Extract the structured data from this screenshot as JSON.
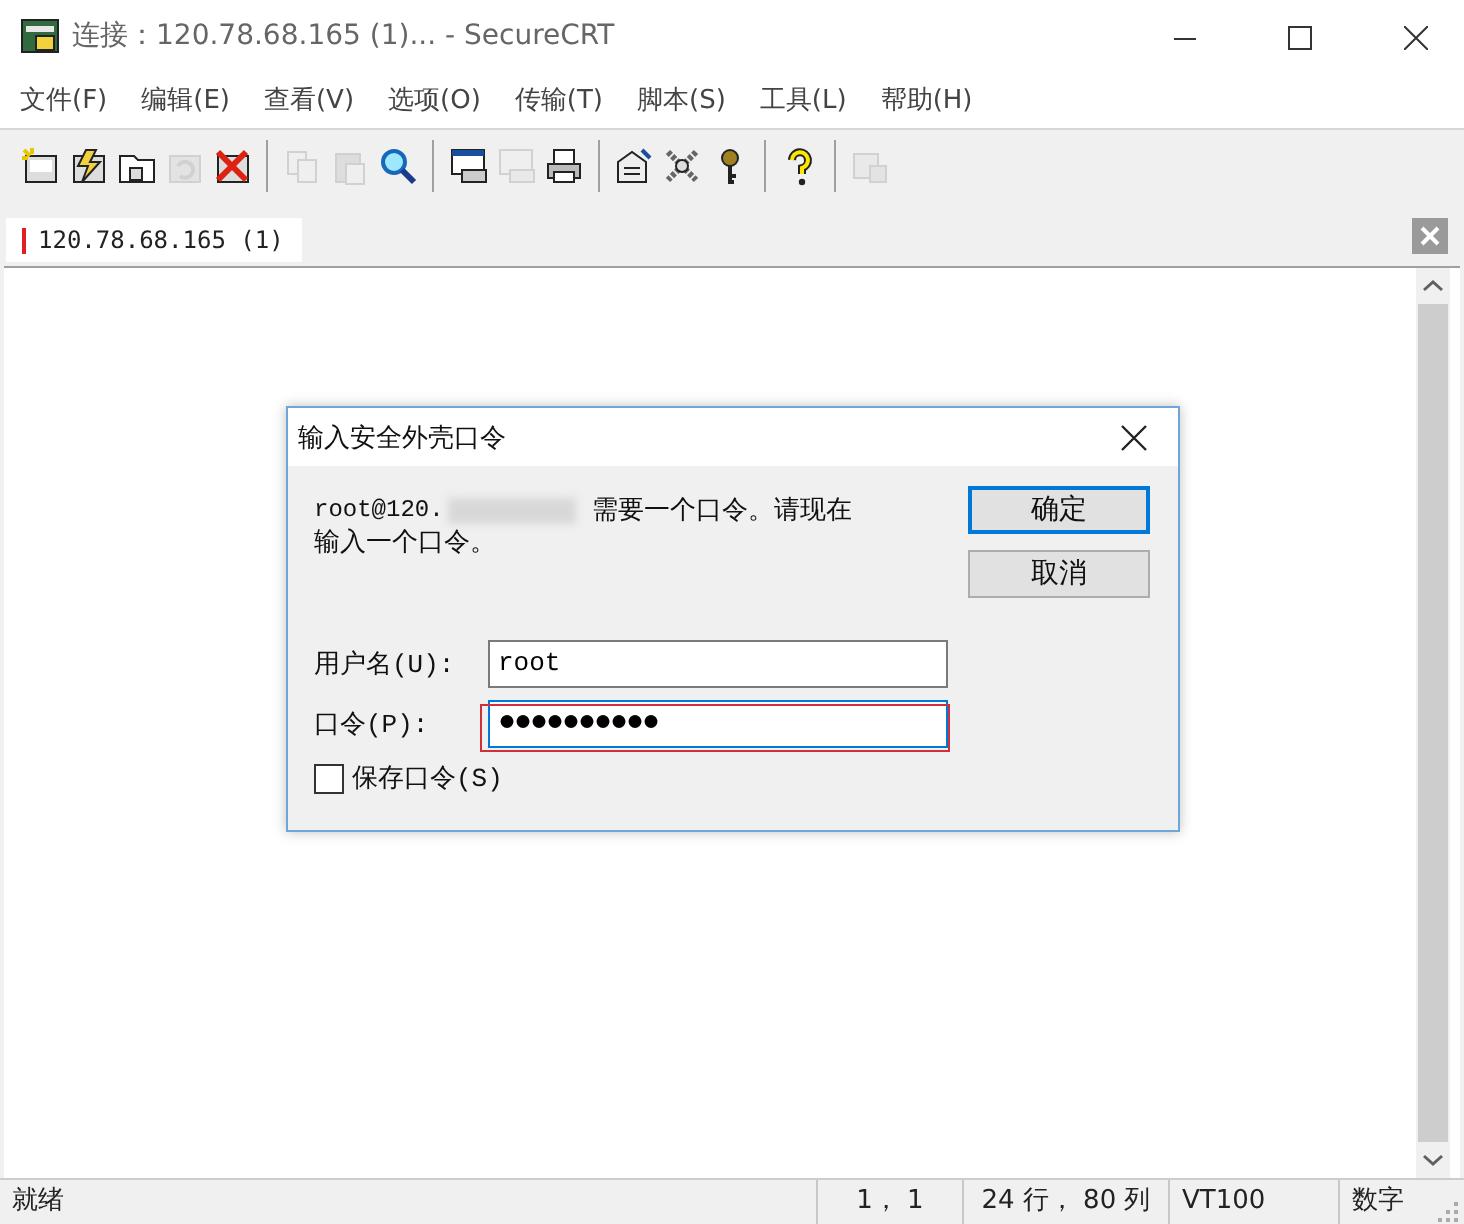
{
  "window": {
    "title": "连接：120.78.68.165 (1)... - SecureCRT"
  },
  "menu": [
    "文件(F)",
    "编辑(E)",
    "查看(V)",
    "选项(O)",
    "传输(T)",
    "脚本(S)",
    "工具(L)",
    "帮助(H)"
  ],
  "toolbar": [
    {
      "kind": "new-session",
      "disabled": false
    },
    {
      "kind": "quick-connect",
      "disabled": false
    },
    {
      "kind": "tab-connect",
      "disabled": false
    },
    {
      "kind": "reconnect",
      "disabled": true
    },
    {
      "kind": "disconnect",
      "disabled": false
    },
    {
      "kind": "separator"
    },
    {
      "kind": "copy",
      "disabled": true
    },
    {
      "kind": "paste",
      "disabled": true
    },
    {
      "kind": "find",
      "disabled": false
    },
    {
      "kind": "separator"
    },
    {
      "kind": "print-screen",
      "disabled": false
    },
    {
      "kind": "print-selection",
      "disabled": true
    },
    {
      "kind": "print",
      "disabled": false
    },
    {
      "kind": "separator"
    },
    {
      "kind": "session-options",
      "disabled": false
    },
    {
      "kind": "global-options",
      "disabled": false
    },
    {
      "kind": "key",
      "disabled": false
    },
    {
      "kind": "separator"
    },
    {
      "kind": "help",
      "disabled": false
    },
    {
      "kind": "separator"
    },
    {
      "kind": "sftp",
      "disabled": true
    }
  ],
  "tabs": [
    {
      "label": "120.78.68.165 (1)",
      "selected": true
    }
  ],
  "dialog": {
    "title": "输入安全外壳口令",
    "message_prefix": "root@120.",
    "message": [
      "需要一个口令。请现在",
      "输入一个口令。"
    ],
    "buttons": [
      {
        "label": "确定",
        "selected": true
      },
      {
        "label": "取消",
        "selected": false
      }
    ],
    "fields": [
      {
        "label": "用户名(U):",
        "value": "root",
        "focused": false
      },
      {
        "label": "口令(P):",
        "value": "●●●●●●●●●●",
        "focused": true
      }
    ],
    "checkbox": {
      "label": "保存口令(S)",
      "checked": false
    }
  },
  "status_bar": [
    "就绪",
    "1， 1",
    "24 行， 80 列",
    "VT100",
    "数字"
  ]
}
